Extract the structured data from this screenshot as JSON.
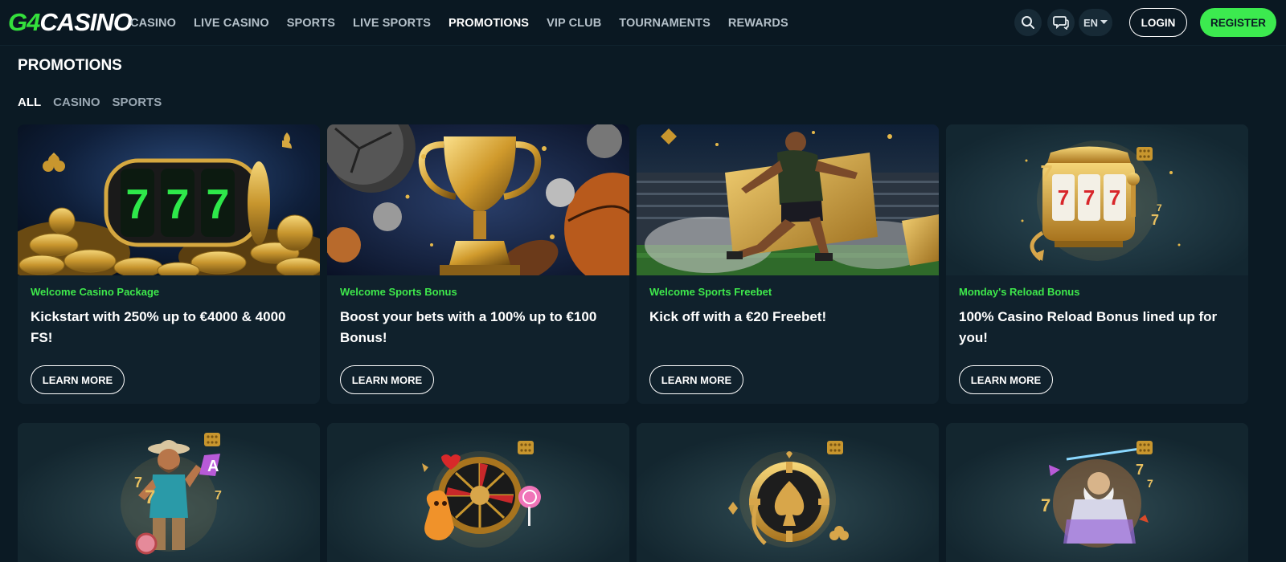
{
  "brand": {
    "logo_g4": "G4",
    "logo_casino": "CASINO"
  },
  "nav": {
    "items": [
      {
        "label": "CASINO",
        "active": false
      },
      {
        "label": "LIVE CASINO",
        "active": false
      },
      {
        "label": "SPORTS",
        "active": false
      },
      {
        "label": "LIVE SPORTS",
        "active": false
      },
      {
        "label": "PROMOTIONS",
        "active": true
      },
      {
        "label": "VIP CLUB",
        "active": false
      },
      {
        "label": "TOURNAMENTS",
        "active": false
      },
      {
        "label": "REWARDS",
        "active": false
      }
    ]
  },
  "header_actions": {
    "search_icon": "search-icon",
    "chat_icon": "chat-icon",
    "language": "EN",
    "login_label": "LOGIN",
    "register_label": "REGISTER"
  },
  "page": {
    "title": "PROMOTIONS",
    "filters": [
      {
        "label": "ALL",
        "active": true
      },
      {
        "label": "CASINO",
        "active": false
      },
      {
        "label": "SPORTS",
        "active": false
      }
    ]
  },
  "promotions": [
    {
      "category": "Welcome Casino Package",
      "title": "Kickstart with 250% up to €4000 & 4000 FS!",
      "button": "LEARN MORE",
      "image": "slot-777-gold-coins"
    },
    {
      "category": "Welcome Sports Bonus",
      "title": "Boost your bets with a 100% up to €100 Bonus!",
      "button": "LEARN MORE",
      "image": "golden-trophy-balls"
    },
    {
      "category": "Welcome Sports Freebet",
      "title": "Kick off with a €20 Freebet!",
      "button": "LEARN MORE",
      "image": "football-player-ticket"
    },
    {
      "category": "Monday's Reload Bonus",
      "title": "100% Casino Reload Bonus lined up for you!",
      "button": "LEARN MORE",
      "image": "golden-slot-machine"
    },
    {
      "image": "cowboy-character"
    },
    {
      "image": "roulette-candy"
    },
    {
      "image": "poker-chip-spade"
    },
    {
      "image": "zeus-character"
    }
  ],
  "colors": {
    "background": "#0b1a24",
    "card": "#10212c",
    "accent_green": "#3ee84b",
    "gold": "#d9a93a"
  }
}
